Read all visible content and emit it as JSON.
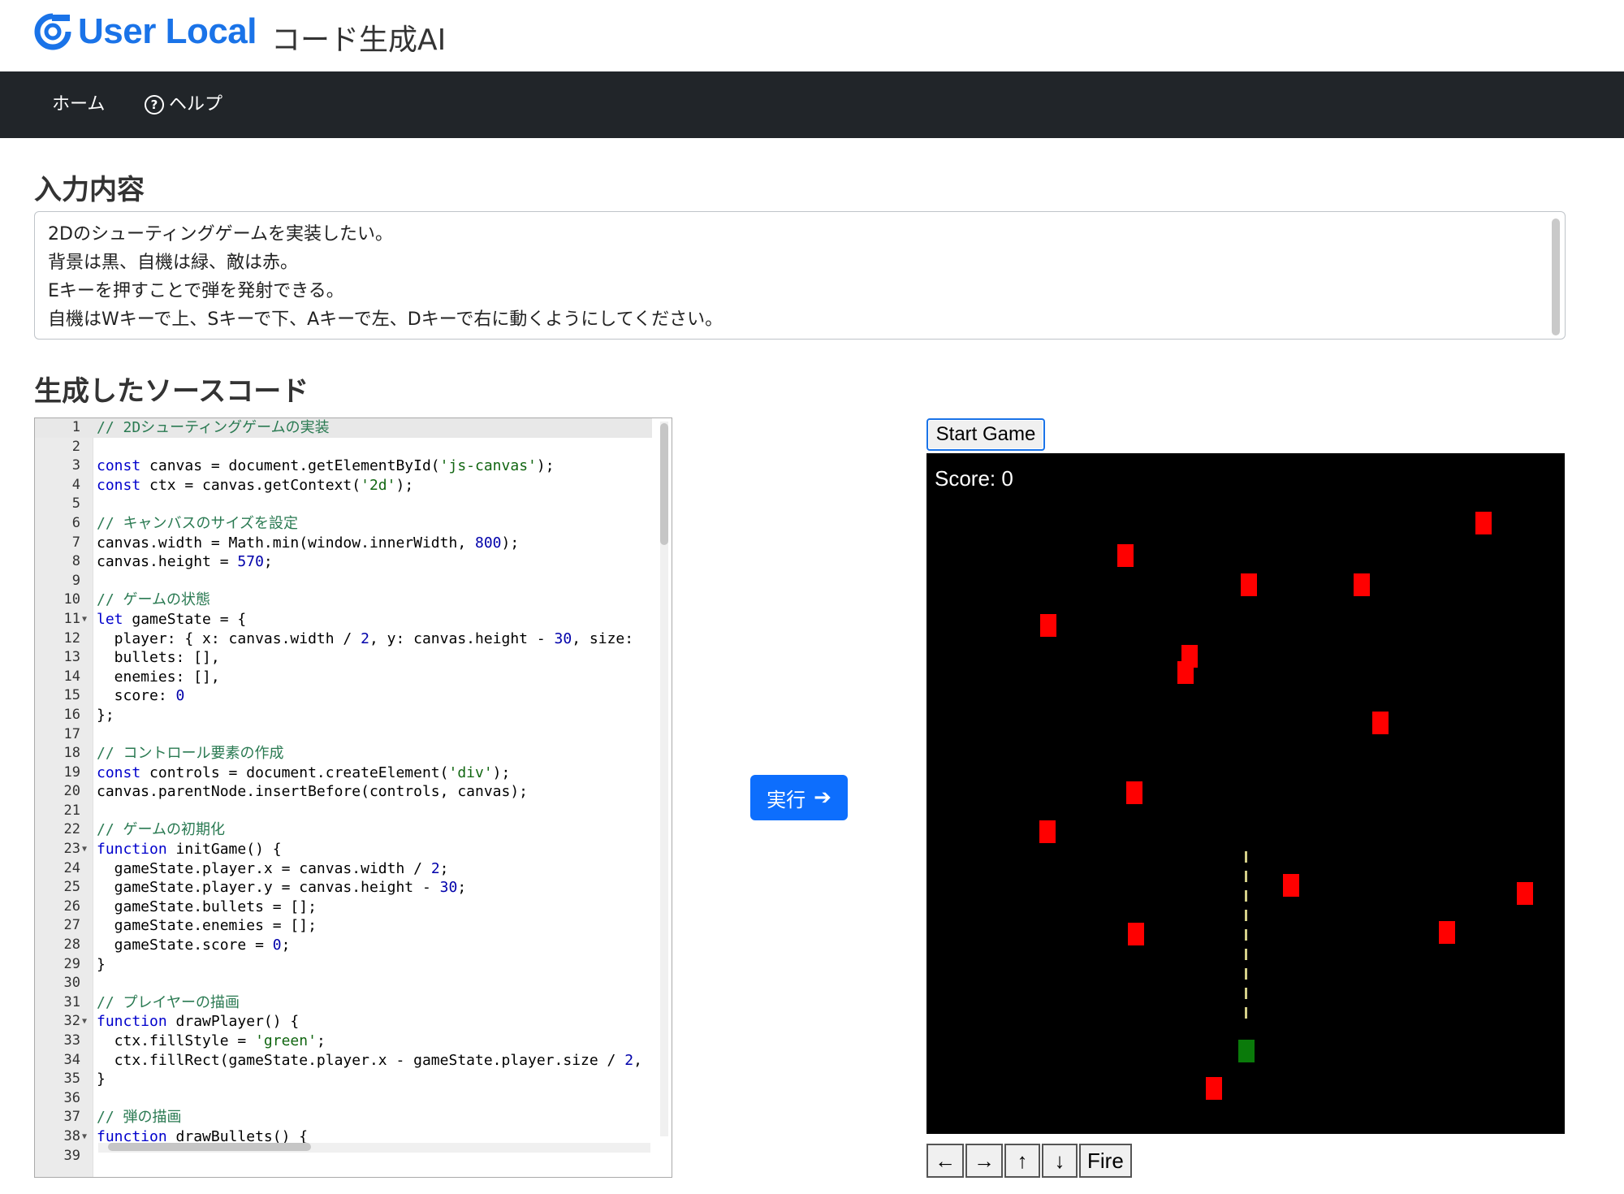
{
  "brand": {
    "logo_text": "User Local",
    "app_title": "コード生成AI"
  },
  "nav": {
    "home": "ホーム",
    "help_icon": "?",
    "help": "ヘルプ"
  },
  "input_section": {
    "heading": "入力内容",
    "lines": [
      "2Dのシューティングゲームを実装したい。",
      "背景は黒、自機は緑、敵は赤。",
      "Eキーを押すことで弾を発射できる。",
      "自機はWキーで上、Sキーで下、Aキーで左、Dキーで右に動くようにしてください。"
    ]
  },
  "code_section": {
    "heading": "生成したソースコード",
    "run_button": "実行",
    "code_lines": [
      "// 2Dシューティングゲームの実装",
      "",
      "const canvas = document.getElementById('js-canvas');",
      "const ctx = canvas.getContext('2d');",
      "",
      "// キャンバスのサイズを設定",
      "canvas.width = Math.min(window.innerWidth, 800);",
      "canvas.height = 570;",
      "",
      "// ゲームの状態",
      "let gameState = {",
      "  player: { x: canvas.width / 2, y: canvas.height - 30, size:",
      "  bullets: [],",
      "  enemies: [],",
      "  score: 0",
      "};",
      "",
      "// コントロール要素の作成",
      "const controls = document.createElement('div');",
      "canvas.parentNode.insertBefore(controls, canvas);",
      "",
      "// ゲームの初期化",
      "function initGame() {",
      "  gameState.player.x = canvas.width / 2;",
      "  gameState.player.y = canvas.height - 30;",
      "  gameState.bullets = [];",
      "  gameState.enemies = [];",
      "  gameState.score = 0;",
      "}",
      "",
      "// プレイヤーの描画",
      "function drawPlayer() {",
      "  ctx.fillStyle = 'green';",
      "  ctx.fillRect(gameState.player.x - gameState.player.size / 2,",
      "}",
      "",
      "// 弾の描画",
      "function drawBullets() {",
      ""
    ],
    "fold_lines": [
      11,
      23,
      32,
      38
    ]
  },
  "game": {
    "start_button": "Start Game",
    "score_text": "Score: 0",
    "controls": [
      "←",
      "→",
      "↑",
      "↓",
      "Fire"
    ],
    "colors": {
      "background": "#000000",
      "enemy": "#ff0000",
      "player": "#0a7a0a",
      "bullet": "#d4cf88"
    }
  }
}
